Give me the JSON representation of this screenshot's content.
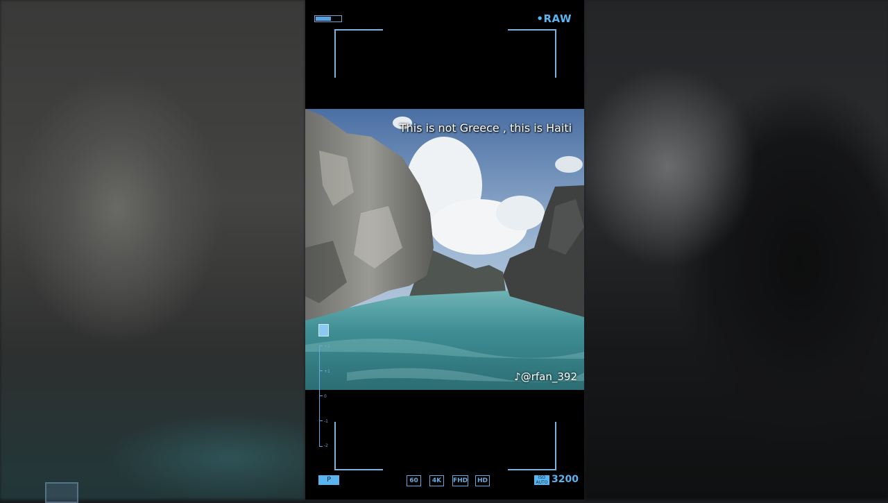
{
  "overlay": {
    "raw_label": "•RAW",
    "battery_level": 0.6,
    "mode_label": "P",
    "chips": [
      "60",
      "4K",
      "FHD",
      "HD"
    ],
    "iso_label": "ISO AUTO",
    "iso_value": "3200",
    "exposure_scale": [
      "+2",
      "+1",
      "0",
      "-1",
      "-2"
    ]
  },
  "video": {
    "caption": "This is not Greece , this is Haiti",
    "watermark": "@rfan_392"
  },
  "colors": {
    "accent": "#5ab4f0",
    "frame": "#7db3dd",
    "water": "#3f8f95"
  }
}
